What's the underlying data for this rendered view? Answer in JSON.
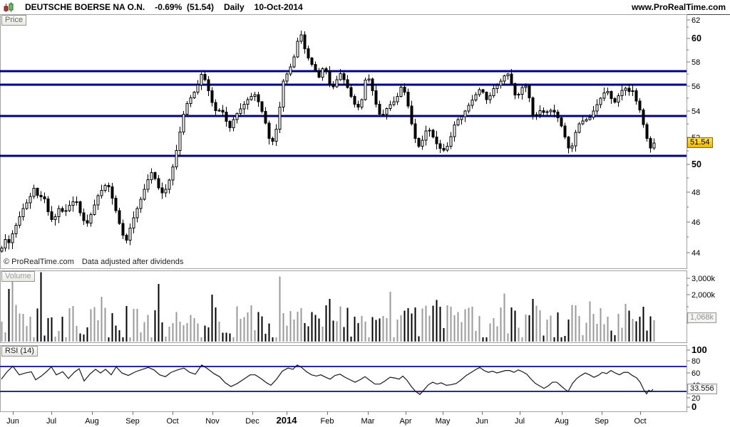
{
  "header": {
    "symbol": "DEUTSCHE BOERSE NA O.N.",
    "change": "-0.69%",
    "last_paren": "(51.54)",
    "timeframe": "Daily",
    "date": "10-Oct-2014",
    "watermark": "www.ProRealTime.com"
  },
  "panels": {
    "price_tab": "Price",
    "volume_tab": "Volume",
    "rsi_tab": "RSI (14)",
    "copyright": "© ProRealTime.com",
    "note": "Data adjusted after dividends"
  },
  "labels": {
    "last_price": "51.54",
    "last_volume": "1,068k",
    "last_rsi": "33.556"
  },
  "colors": {
    "navy_line": "#000085",
    "rsi_band_line": "#2929a3",
    "rsi_line": "#1a1a1a",
    "overbought_fill": "#eec0c0",
    "candle_stroke": "#000000",
    "candle_up_fill": "#ffffff",
    "candle_down_fill": "#000000",
    "volume_dark": "#000000",
    "volume_light": "#9a9a9a",
    "panel_border": "#a3a3a3",
    "tick_color": "#777777",
    "label_bg_yellow": "#f5c518"
  },
  "chart_data": {
    "type": "candlestick",
    "instrument": "DEUTSCHE BOERSE NA O.N.",
    "period": "Daily",
    "last_date": "10-Oct-2014",
    "price_panel": {
      "type": "candlestick",
      "scale": "log",
      "y_ticks": [
        62,
        60,
        58,
        56,
        54,
        52,
        50,
        48,
        46,
        44
      ],
      "bold_ticks": [
        60,
        50
      ],
      "minor_ticks": [
        61,
        59,
        57,
        55,
        53,
        51,
        49,
        47,
        45
      ],
      "horizontal_lines": [
        57.2,
        56.1,
        53.62,
        50.6
      ],
      "last_price": 51.54,
      "ylim_approx": [
        43.7,
        62.0
      ],
      "close_path": [
        [
          2,
          44.3
        ],
        [
          6,
          45.0
        ],
        [
          10,
          44.4
        ],
        [
          16,
          45.1
        ],
        [
          24,
          46.0
        ],
        [
          32,
          46.9
        ],
        [
          40,
          47.5
        ],
        [
          48,
          48.4
        ],
        [
          54,
          47.5
        ],
        [
          60,
          47.9
        ],
        [
          68,
          46.5
        ],
        [
          74,
          46.0
        ],
        [
          82,
          46.9
        ],
        [
          90,
          46.6
        ],
        [
          98,
          47.2
        ],
        [
          106,
          47.5
        ],
        [
          114,
          46.3
        ],
        [
          121,
          45.8
        ],
        [
          128,
          46.6
        ],
        [
          136,
          47.7
        ],
        [
          144,
          48.3
        ],
        [
          150,
          48.7
        ],
        [
          157,
          47.6
        ],
        [
          164,
          46.4
        ],
        [
          171,
          45.2
        ],
        [
          177,
          44.8
        ],
        [
          184,
          45.9
        ],
        [
          192,
          46.9
        ],
        [
          199,
          47.8
        ],
        [
          206,
          48.8
        ],
        [
          212,
          49.4
        ],
        [
          218,
          48.9
        ],
        [
          225,
          47.9
        ],
        [
          231,
          48.1
        ],
        [
          238,
          49.0
        ],
        [
          244,
          50.2
        ],
        [
          250,
          51.8
        ],
        [
          256,
          53.6
        ],
        [
          262,
          54.6
        ],
        [
          269,
          55.2
        ],
        [
          276,
          55.9
        ],
        [
          283,
          57.1
        ],
        [
          289,
          56.2
        ],
        [
          296,
          54.8
        ],
        [
          303,
          53.9
        ],
        [
          310,
          54.2
        ],
        [
          317,
          53.2
        ],
        [
          322,
          52.7
        ],
        [
          329,
          53.6
        ],
        [
          336,
          54.1
        ],
        [
          343,
          54.6
        ],
        [
          350,
          55.1
        ],
        [
          357,
          55.3
        ],
        [
          364,
          54.5
        ],
        [
          371,
          53.3
        ],
        [
          377,
          51.9
        ],
        [
          381,
          51.5
        ],
        [
          387,
          52.6
        ],
        [
          392,
          54.3
        ],
        [
          397,
          56.4
        ],
        [
          403,
          57.1
        ],
        [
          409,
          57.8
        ],
        [
          415,
          59.0
        ],
        [
          420,
          60.8
        ],
        [
          424,
          59.8
        ],
        [
          429,
          58.6
        ],
        [
          435,
          58.0
        ],
        [
          441,
          57.3
        ],
        [
          447,
          56.7
        ],
        [
          452,
          57.4
        ],
        [
          457,
          57.2
        ],
        [
          462,
          56.1
        ],
        [
          466,
          55.8
        ],
        [
          471,
          56.4
        ],
        [
          477,
          57.0
        ],
        [
          483,
          56.4
        ],
        [
          489,
          55.6
        ],
        [
          495,
          54.7
        ],
        [
          501,
          54.2
        ],
        [
          507,
          54.9
        ],
        [
          513,
          56.8
        ],
        [
          518,
          56.5
        ],
        [
          523,
          55.4
        ],
        [
          528,
          54.3
        ],
        [
          533,
          53.6
        ],
        [
          538,
          53.8
        ],
        [
          544,
          54.4
        ],
        [
          550,
          54.6
        ],
        [
          556,
          55.0
        ],
        [
          562,
          55.9
        ],
        [
          567,
          55.5
        ],
        [
          572,
          54.4
        ],
        [
          577,
          53.0
        ],
        [
          582,
          51.9
        ],
        [
          588,
          51.2
        ],
        [
          593,
          51.9
        ],
        [
          598,
          52.6
        ],
        [
          603,
          52.5
        ],
        [
          608,
          51.9
        ],
        [
          613,
          51.4
        ],
        [
          618,
          51.1
        ],
        [
          623,
          51.0
        ],
        [
          628,
          51.4
        ],
        [
          633,
          52.2
        ],
        [
          638,
          53.1
        ],
        [
          643,
          53.4
        ],
        [
          648,
          53.6
        ],
        [
          654,
          54.2
        ],
        [
          660,
          54.7
        ],
        [
          666,
          55.2
        ],
        [
          672,
          55.7
        ],
        [
          677,
          55.5
        ],
        [
          682,
          54.9
        ],
        [
          687,
          55.2
        ],
        [
          693,
          55.9
        ],
        [
          699,
          56.1
        ],
        [
          705,
          56.7
        ],
        [
          711,
          57.1
        ],
        [
          716,
          56.4
        ],
        [
          721,
          55.3
        ],
        [
          726,
          55.2
        ],
        [
          731,
          55.8
        ],
        [
          736,
          56.1
        ],
        [
          740,
          55.6
        ],
        [
          744,
          54.5
        ],
        [
          748,
          53.4
        ],
        [
          753,
          53.8
        ],
        [
          758,
          54.1
        ],
        [
          764,
          53.8
        ],
        [
          770,
          54.1
        ],
        [
          776,
          54.0
        ],
        [
          781,
          53.6
        ],
        [
          786,
          53.0
        ],
        [
          791,
          52.2
        ],
        [
          796,
          51.3
        ],
        [
          800,
          50.9
        ],
        [
          805,
          52.0
        ],
        [
          810,
          52.9
        ],
        [
          815,
          53.2
        ],
        [
          820,
          53.3
        ],
        [
          826,
          53.4
        ],
        [
          832,
          54.0
        ],
        [
          838,
          54.6
        ],
        [
          844,
          55.2
        ],
        [
          850,
          55.7
        ],
        [
          855,
          55.3
        ],
        [
          860,
          54.5
        ],
        [
          865,
          55.0
        ],
        [
          870,
          55.5
        ],
        [
          876,
          55.9
        ],
        [
          881,
          55.5
        ],
        [
          886,
          55.8
        ],
        [
          891,
          54.9
        ],
        [
          896,
          54.3
        ],
        [
          900,
          53.4
        ],
        [
          904,
          52.5
        ],
        [
          908,
          51.7
        ],
        [
          912,
          51.2
        ],
        [
          915,
          51.6
        ],
        [
          918,
          51.54
        ]
      ]
    },
    "volume_panel": {
      "type": "bar",
      "scale": "log",
      "unit": "k",
      "y_tick_labels": [
        "3,000k",
        "2,000k"
      ],
      "y_tick_values": [
        3000,
        2000
      ],
      "minor_tick_values": [
        2500,
        1500,
        1000
      ],
      "last_volume": 1068,
      "typical_range": [
        600,
        1550
      ],
      "spikes": [
        [
          13,
          2300
        ],
        [
          16,
          3300
        ],
        [
          55,
          3450
        ],
        [
          144,
          1900
        ],
        [
          224,
          2600
        ],
        [
          298,
          2000
        ],
        [
          393,
          3100
        ],
        [
          460,
          1800
        ],
        [
          549,
          2150
        ],
        [
          612,
          1750
        ],
        [
          709,
          2050
        ],
        [
          745,
          1800
        ],
        [
          800,
          1550
        ],
        [
          828,
          1700
        ],
        [
          879,
          1600
        ],
        [
          915,
          1068
        ]
      ]
    },
    "rsi_panel": {
      "type": "line",
      "label": "RSI (14)",
      "y_ticks": [
        100,
        80,
        60,
        40,
        20,
        0
      ],
      "bold_ticks": [
        100,
        0
      ],
      "overbought": 70,
      "oversold": 30,
      "last_value": 33.556,
      "values": [
        [
          2,
          50
        ],
        [
          10,
          62
        ],
        [
          18,
          71
        ],
        [
          27,
          57
        ],
        [
          36,
          60
        ],
        [
          44,
          62
        ],
        [
          50,
          49
        ],
        [
          58,
          55
        ],
        [
          66,
          63
        ],
        [
          72,
          70
        ],
        [
          79,
          57
        ],
        [
          88,
          62
        ],
        [
          96,
          51
        ],
        [
          104,
          61
        ],
        [
          111,
          67
        ],
        [
          118,
          47
        ],
        [
          126,
          58
        ],
        [
          134,
          66
        ],
        [
          141,
          60
        ],
        [
          148,
          66
        ],
        [
          156,
          57
        ],
        [
          163,
          70
        ],
        [
          171,
          60
        ],
        [
          180,
          56
        ],
        [
          190,
          62
        ],
        [
          200,
          66
        ],
        [
          208,
          69
        ],
        [
          216,
          65
        ],
        [
          224,
          57
        ],
        [
          232,
          54
        ],
        [
          240,
          61
        ],
        [
          249,
          65
        ],
        [
          258,
          68
        ],
        [
          266,
          61
        ],
        [
          274,
          58
        ],
        [
          283,
          73
        ],
        [
          291,
          67
        ],
        [
          300,
          59
        ],
        [
          308,
          54
        ],
        [
          316,
          44
        ],
        [
          324,
          38
        ],
        [
          333,
          43
        ],
        [
          342,
          50
        ],
        [
          351,
          57
        ],
        [
          358,
          57
        ],
        [
          366,
          51
        ],
        [
          374,
          44
        ],
        [
          380,
          40
        ],
        [
          388,
          50
        ],
        [
          396,
          63
        ],
        [
          404,
          68
        ],
        [
          411,
          66
        ],
        [
          417,
          73
        ],
        [
          423,
          69
        ],
        [
          430,
          62
        ],
        [
          437,
          57
        ],
        [
          444,
          55
        ],
        [
          450,
          57
        ],
        [
          457,
          53
        ],
        [
          463,
          50
        ],
        [
          470,
          56
        ],
        [
          477,
          58
        ],
        [
          484,
          53
        ],
        [
          491,
          49
        ],
        [
          498,
          45
        ],
        [
          505,
          49
        ],
        [
          512,
          54
        ],
        [
          519,
          48
        ],
        [
          526,
          42
        ],
        [
          533,
          42
        ],
        [
          540,
          47
        ],
        [
          547,
          53
        ],
        [
          553,
          52
        ],
        [
          560,
          50
        ],
        [
          565,
          55
        ],
        [
          571,
          48
        ],
        [
          577,
          38
        ],
        [
          583,
          30
        ],
        [
          589,
          25
        ],
        [
          595,
          33
        ],
        [
          601,
          41
        ],
        [
          607,
          45
        ],
        [
          613,
          42
        ],
        [
          619,
          44
        ],
        [
          626,
          40
        ],
        [
          633,
          41
        ],
        [
          640,
          43
        ],
        [
          647,
          49
        ],
        [
          654,
          56
        ],
        [
          661,
          61
        ],
        [
          668,
          66
        ],
        [
          673,
          69
        ],
        [
          679,
          64
        ],
        [
          685,
          61
        ],
        [
          691,
          63
        ],
        [
          697,
          60
        ],
        [
          703,
          62
        ],
        [
          709,
          64
        ],
        [
          715,
          64
        ],
        [
          721,
          61
        ],
        [
          727,
          65
        ],
        [
          733,
          62
        ],
        [
          739,
          58
        ],
        [
          745,
          50
        ],
        [
          751,
          43
        ],
        [
          757,
          39
        ],
        [
          763,
          35
        ],
        [
          769,
          39
        ],
        [
          775,
          45
        ],
        [
          781,
          45
        ],
        [
          787,
          39
        ],
        [
          793,
          33
        ],
        [
          797,
          30
        ],
        [
          803,
          43
        ],
        [
          809,
          51
        ],
        [
          815,
          56
        ],
        [
          821,
          60
        ],
        [
          827,
          57
        ],
        [
          833,
          53
        ],
        [
          839,
          56
        ],
        [
          845,
          61
        ],
        [
          851,
          59
        ],
        [
          857,
          64
        ],
        [
          863,
          60
        ],
        [
          869,
          57
        ],
        [
          875,
          61
        ],
        [
          881,
          61
        ],
        [
          887,
          56
        ],
        [
          893,
          52
        ],
        [
          898,
          45
        ],
        [
          903,
          33
        ],
        [
          907,
          26
        ],
        [
          910,
          32
        ],
        [
          913,
          30
        ],
        [
          916,
          33.556
        ]
      ]
    },
    "x_axis": {
      "labels": [
        "Jun",
        "Jul",
        "Aug",
        "Sep",
        "Oct",
        "Nov",
        "Dec",
        "2014",
        "Feb",
        "Mar",
        "Apr",
        "May",
        "Jun",
        "Jul",
        "Aug",
        "Sep",
        "Oct"
      ],
      "bold": [
        "2014"
      ],
      "positions": [
        18,
        72,
        129,
        186,
        242,
        298,
        354,
        402,
        459,
        516,
        569,
        621,
        676,
        729,
        788,
        844,
        898
      ]
    }
  }
}
